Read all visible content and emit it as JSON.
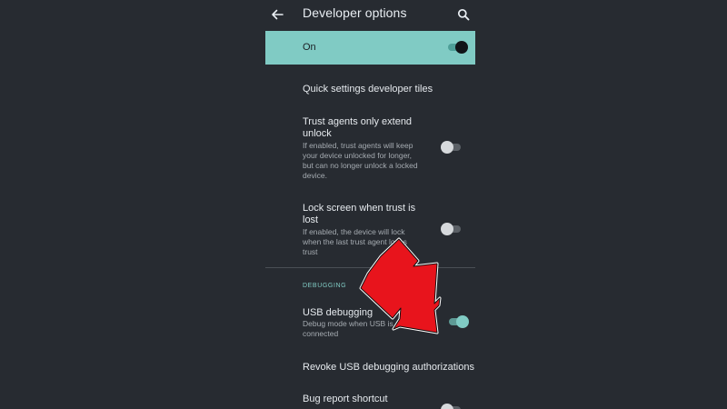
{
  "appbar": {
    "title": "Developer options",
    "back_icon": "back-arrow-icon",
    "search_icon": "search-icon"
  },
  "master_switch": {
    "label": "On",
    "checked": true
  },
  "items": [
    {
      "title": "Quick settings developer tiles"
    },
    {
      "title_line1": "Trust agents only extend",
      "title_line2": "unlock",
      "summary_line1": "If enabled, trust agents will keep",
      "summary_line2": "your device unlocked for longer,",
      "summary_line3": "but can no longer unlock a locked",
      "summary_line4": "device.",
      "checked": false
    },
    {
      "title_line1": "Lock screen when trust is",
      "title_line2": "lost",
      "summary_line1": "If enabled, the device will lock",
      "summary_line2": "when the last trust agent loses",
      "summary_line3": "trust",
      "checked": false
    }
  ],
  "debugging": {
    "header": "DEBUGGING",
    "usb_debugging": {
      "title": "USB debugging",
      "summary_line1": "Debug mode when USB is",
      "summary_line2": "connected",
      "checked": true
    },
    "revoke": {
      "title": "Revoke USB debugging authorizations"
    },
    "bug_report": {
      "title": "Bug report shortcut",
      "checked": false
    }
  },
  "colors": {
    "background": "#272b31",
    "accent": "#80cbc4",
    "annotation_arrow": "#e8141c"
  }
}
